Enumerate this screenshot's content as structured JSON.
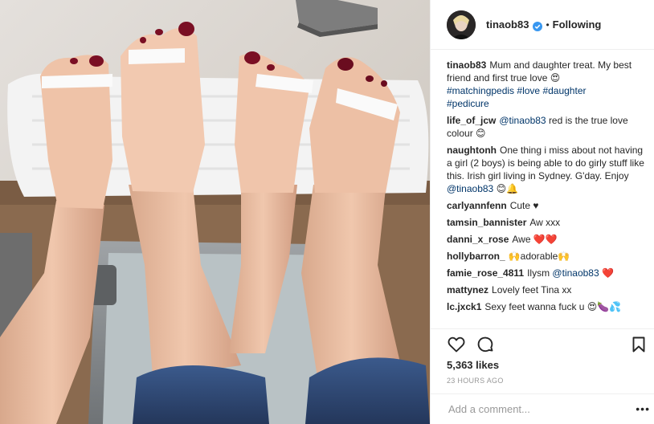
{
  "post": {
    "username": "tinaob83",
    "follow_status": "Following",
    "dot": "•",
    "caption": {
      "user": "tinaob83",
      "text": "Mum and daughter treat. My best friend and first true love",
      "emoji": "😍",
      "hashtags": [
        "#matchingpedis",
        "#love",
        "#daughter",
        "#pedicure"
      ]
    },
    "comments": [
      {
        "user": "life_of_jcw",
        "mention": "@tinaob83",
        "text": "red is the true love colour",
        "emoji": "😊"
      },
      {
        "user": "naughtonh",
        "text": "One thing i miss about not having a girl (2 boys) is being able to do girly stuff like this. Irish girl living in Sydney. G'day. Enjoy",
        "mention": "@tinaob83",
        "emoji": "😊🔔"
      },
      {
        "user": "carlyannfenn",
        "text": "Cute",
        "emoji": "♥"
      },
      {
        "user": "tamsin_bannister",
        "text": "Aw xxx"
      },
      {
        "user": "danni_x_rose",
        "text": "Awe",
        "emoji": "❤️❤️"
      },
      {
        "user": "hollybarron_",
        "emoji_before": "🙌",
        "text": "adorable",
        "emoji": "🙌"
      },
      {
        "user": "famie_rose_4811",
        "text": "Ilysm",
        "mention": "@tinaob83",
        "emoji": "❤️"
      },
      {
        "user": "mattynez",
        "text": "Lovely feet Tina xx"
      },
      {
        "user": "lc.jxck1",
        "text": "Sexy feet wanna fuck u",
        "emoji": "😍🍆💦"
      }
    ],
    "likes": "5,363 likes",
    "timestamp": "23 HOURS AGO",
    "add_comment_placeholder": "Add a comment...",
    "more_label": "•••",
    "icons": {
      "like": "heart-outline-icon",
      "comment": "speech-bubble-icon",
      "save": "bookmark-icon",
      "verified": "verified-badge-icon"
    },
    "colors": {
      "link": "#003569",
      "verified": "#3897f0",
      "muted": "#999999",
      "text": "#262626",
      "heart": "#ed4956"
    }
  }
}
